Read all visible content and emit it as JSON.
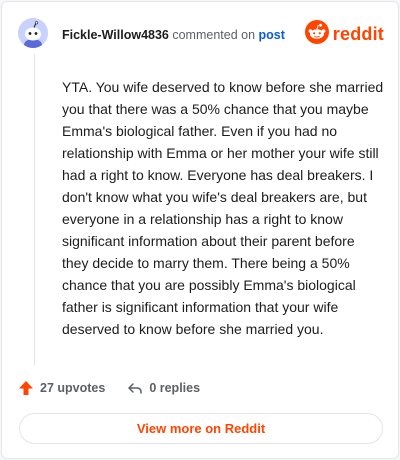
{
  "comment": {
    "username": "Fickle-Willow4836",
    "action_text": "commented on",
    "post_link": "post",
    "body": "YTA. You wife deserved to know before she married you that there was a 50% chance that you maybe Emma's biological father. Even if you had no relationship with Emma or her mother your wife still had a right to know. Everyone has deal breakers. I don't know what you wife's deal breakers are, but everyone in a relationship has a right to know significant information about their parent before they decide to marry them. There being a 50% chance that you are possibly Emma's biological father is significant information that your wife deserved to know before she married you."
  },
  "brand": {
    "name": "reddit",
    "color": "#ff4500",
    "icon": "reddit-snoo-icon"
  },
  "avatar": {
    "icon": "snoo-avatar-icon",
    "background": "#c9d2ff"
  },
  "stats": {
    "upvotes": "27 upvotes",
    "replies": "0 replies",
    "upvote_icon": "upvote-arrow-icon",
    "reply_icon": "reply-arrow-icon"
  },
  "cta": {
    "label": "View more on Reddit"
  }
}
